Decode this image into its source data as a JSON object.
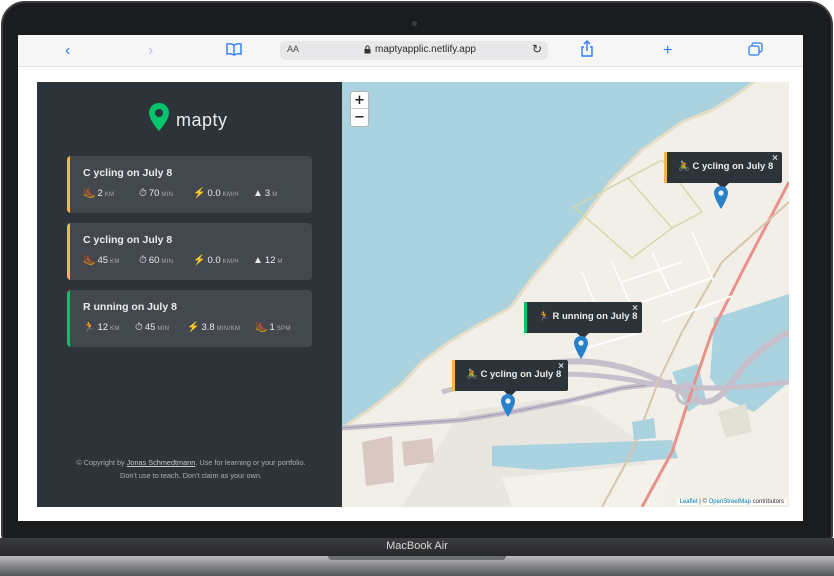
{
  "browser": {
    "aa_label": "AA",
    "url": "maptyapplic.netlify.app",
    "icons": [
      "back-icon",
      "forward-icon",
      "bookmarks-icon",
      "reload-icon",
      "share-icon",
      "new-tab-icon",
      "tabs-icon"
    ]
  },
  "sidebar": {
    "logo_text": "mapty",
    "workouts": [
      {
        "type": "cycling",
        "title": "C ycling on July 8",
        "color": "#ffb545",
        "stats": [
          {
            "icon": "boot-icon",
            "glyph": "🥾",
            "value": "2",
            "unit": "KM"
          },
          {
            "icon": "stopwatch-icon",
            "glyph": "⏱",
            "value": "70",
            "unit": "MIN"
          },
          {
            "icon": "lightning-icon",
            "glyph": "⚡",
            "value": "0.0",
            "unit": "KM/H"
          },
          {
            "icon": "mountain-icon",
            "glyph": "▲",
            "value": "3",
            "unit": "M"
          }
        ]
      },
      {
        "type": "cycling",
        "title": "C ycling on July 8",
        "color": "#ffb545",
        "stats": [
          {
            "icon": "boot-icon",
            "glyph": "🥾",
            "value": "45",
            "unit": "KM"
          },
          {
            "icon": "stopwatch-icon",
            "glyph": "⏱",
            "value": "60",
            "unit": "MIN"
          },
          {
            "icon": "lightning-icon",
            "glyph": "⚡",
            "value": "0.0",
            "unit": "KM/H"
          },
          {
            "icon": "mountain-icon",
            "glyph": "▲",
            "value": "12",
            "unit": "M"
          }
        ]
      },
      {
        "type": "running",
        "title": "R unning on July 8",
        "color": "#00c46a",
        "stats": [
          {
            "icon": "runner-icon",
            "glyph": "🏃",
            "value": "12",
            "unit": "KM"
          },
          {
            "icon": "stopwatch-icon",
            "glyph": "⏱",
            "value": "45",
            "unit": "MIN"
          },
          {
            "icon": "lightning-icon",
            "glyph": "⚡",
            "value": "3.8",
            "unit": "MIN/KM"
          },
          {
            "icon": "boot-icon",
            "glyph": "🥾",
            "value": "1",
            "unit": "SPM"
          }
        ]
      }
    ],
    "copyright": {
      "prefix": "© Copyright by ",
      "author": "Jonas Schmedtmann",
      "suffix": ". Use for learning or your portfolio. Don't use to teach. Don't claim as your own."
    }
  },
  "map": {
    "zoom_in": "+",
    "zoom_out": "−",
    "popups": [
      {
        "icon": "bicycle-icon",
        "glyph": "🚴",
        "text": "C ycling on July 8",
        "color": "#ffb545",
        "close": "×"
      },
      {
        "icon": "runner-icon",
        "glyph": "🏃",
        "text": "R unning on July 8",
        "color": "#00c46a",
        "close": "×"
      },
      {
        "icon": "bicycle-icon",
        "glyph": "🚴",
        "text": "C ycling on July 8",
        "color": "#ffb545",
        "close": "×"
      }
    ],
    "attribution": {
      "leaflet": "Leaflet",
      "sep": " | © ",
      "osm": "OpenStreetMap",
      "suffix": " contributors"
    },
    "colors": {
      "sea": "#aad3df",
      "land": "#f2efe9",
      "major_road": "#e8928a",
      "road": "#ffffff"
    }
  },
  "device": {
    "label": "MacBook Air"
  }
}
